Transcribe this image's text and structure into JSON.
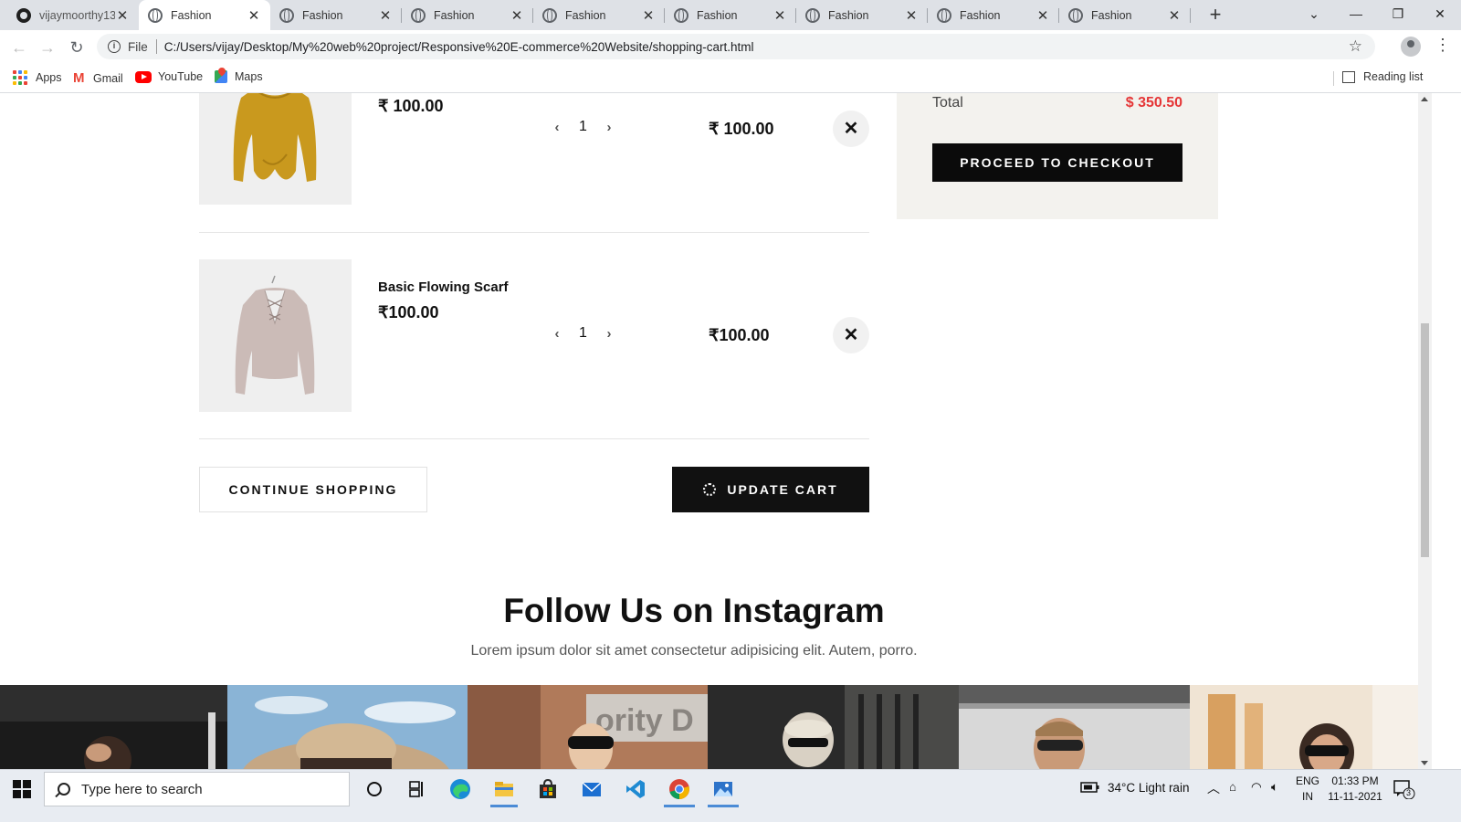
{
  "browser": {
    "tabs": [
      {
        "title": "vijaymoorthy13",
        "favicon": "github-icon",
        "active": false
      },
      {
        "title": "Fashion",
        "favicon": "globe-icon",
        "active": true
      },
      {
        "title": "Fashion",
        "favicon": "globe-icon",
        "active": false
      },
      {
        "title": "Fashion",
        "favicon": "globe-icon",
        "active": false
      },
      {
        "title": "Fashion",
        "favicon": "globe-icon",
        "active": false
      },
      {
        "title": "Fashion",
        "favicon": "globe-icon",
        "active": false
      },
      {
        "title": "Fashion",
        "favicon": "globe-icon",
        "active": false
      },
      {
        "title": "Fashion",
        "favicon": "globe-icon",
        "active": false
      },
      {
        "title": "Fashion",
        "favicon": "globe-icon",
        "active": false
      }
    ],
    "address": {
      "protocol_label": "File",
      "url": "C:/Users/vijay/Desktop/My%20web%20project/Responsive%20E-commerce%20Website/shopping-cart.html"
    },
    "bookmarks": [
      {
        "label": "Apps",
        "icon": "apps-grid-icon"
      },
      {
        "label": "Gmail",
        "icon": "gmail-icon"
      },
      {
        "label": "YouTube",
        "icon": "youtube-icon"
      },
      {
        "label": "Maps",
        "icon": "maps-icon"
      }
    ],
    "reading_list_label": "Reading list"
  },
  "cart": {
    "items": [
      {
        "name": "",
        "price": "₹ 100.00",
        "quantity": "1",
        "total": "₹ 100.00",
        "image": "mustard-sweater"
      },
      {
        "name": "Basic Flowing Scarf",
        "price": "₹100.00",
        "quantity": "1",
        "total": "₹100.00",
        "image": "mauve-lace-sweater"
      }
    ],
    "continue_label": "CONTINUE SHOPPING",
    "update_label": "UPDATE CART"
  },
  "summary": {
    "total_label": "Total",
    "total_value": "$ 350.50",
    "checkout_label": "PROCEED TO CHECKOUT"
  },
  "instagram": {
    "title": "Follow Us on Instagram",
    "subtitle": "Lorem ipsum dolor sit amet consectetur adipisicing elit. Autem, porro."
  },
  "taskbar": {
    "search_placeholder": "Type here to search",
    "weather": "34°C  Light rain",
    "lang_top": "ENG",
    "lang_bottom": "IN",
    "time": "01:33 PM",
    "date": "11-11-2021",
    "notification_count": "3"
  },
  "colors": {
    "accent_red": "#e53637",
    "dark": "#111111",
    "summary_bg": "#f3f2ee"
  }
}
